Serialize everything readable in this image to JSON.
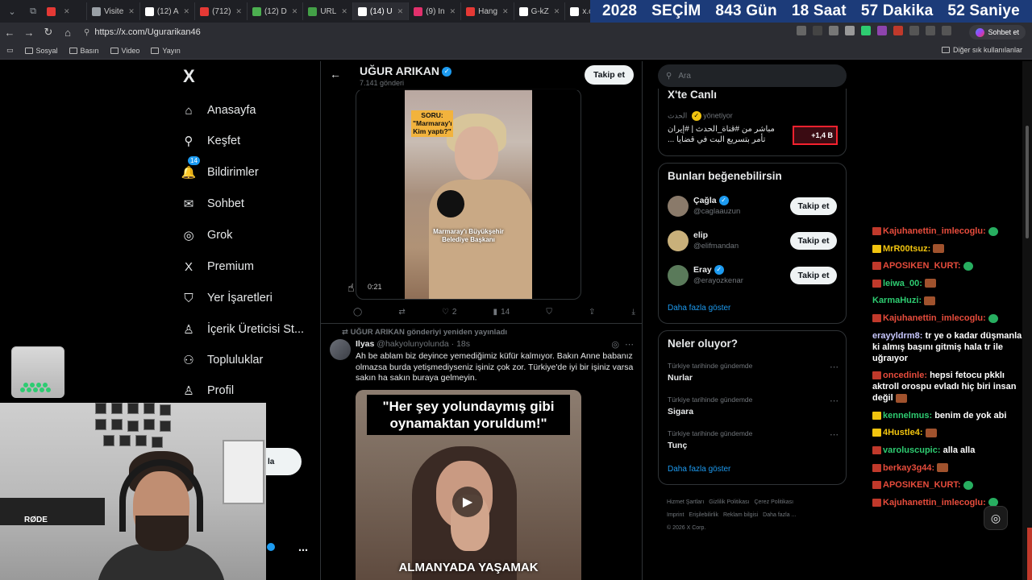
{
  "browser": {
    "tabs": [
      {
        "label": "",
        "color": "#e53935"
      },
      {
        "label": "Visite",
        "color": "#9aa0a6"
      },
      {
        "label": "(12) A",
        "color": "#ffffff"
      },
      {
        "label": "(712)",
        "color": "#e53935"
      },
      {
        "label": "(12) D",
        "color": "#4caf50"
      },
      {
        "label": "URL",
        "color": "#43a047"
      },
      {
        "label": "(14) U",
        "color": "#ffffff"
      },
      {
        "label": "(9) In",
        "color": "#e1306c"
      },
      {
        "label": "Hang",
        "color": "#e53935"
      },
      {
        "label": "G-kZ",
        "color": "#ffffff"
      },
      {
        "label": "x.con",
        "color": "#ffffff"
      },
      {
        "label": "x.con",
        "color": "#ffffff"
      }
    ],
    "countdown": [
      "2028",
      "SEÇİM",
      "843 Gün",
      "18 Saat",
      "57 Dakika",
      "52 Saniye"
    ],
    "url": "https://x.com/Ugurarikan46",
    "profile_label": "Sohbet et",
    "bookmarks": [
      "Sosyal",
      "Basın",
      "Video",
      "Yayın"
    ],
    "bookmarks_right": "Diğer sık kullanılanlar"
  },
  "nav": {
    "logo": "X",
    "items": [
      {
        "label": "Anasayfa",
        "icon": "home-icon",
        "glyph": "⌂"
      },
      {
        "label": "Keşfet",
        "icon": "search-icon",
        "glyph": "⚲"
      },
      {
        "label": "Bildirimler",
        "icon": "bell-icon",
        "glyph": "🔔",
        "badge": "14"
      },
      {
        "label": "Sohbet",
        "icon": "mail-icon",
        "glyph": "✉"
      },
      {
        "label": "Grok",
        "icon": "grok-icon",
        "glyph": "◎"
      },
      {
        "label": "Premium",
        "icon": "x-premium-icon",
        "glyph": "X"
      },
      {
        "label": "Yer İşaretleri",
        "icon": "bookmark-icon",
        "glyph": "⛉"
      },
      {
        "label": "İçerik Üreticisi St...",
        "icon": "creator-studio-icon",
        "glyph": "♙"
      },
      {
        "label": "Topluluklar",
        "icon": "communities-icon",
        "glyph": "⚇"
      },
      {
        "label": "Profil",
        "icon": "profile-icon",
        "glyph": "♙"
      }
    ],
    "post_button_fragment": "la"
  },
  "profile": {
    "name": "UĞUR ARIKAN",
    "posts_count": "7.141 gönderi",
    "follow_label": "Takip et"
  },
  "tweet1": {
    "video": {
      "question": "SORU: \"Marmaray'ı Kim yaptı?\"",
      "caption": "Marmaray'ı Büyükşehir Belediye Başkanı",
      "time": "0:21"
    },
    "actions": {
      "reply": "",
      "repost": "",
      "likes": "2",
      "views": "14"
    }
  },
  "tweet2": {
    "repost_note": "UĞUR ARIKAN gönderiyi yeniden yayınladı",
    "author": "Ilyas",
    "handle": "@hakyolunyolunda · 18s",
    "text": "Ah be ablam biz deyince yemediğimiz küfür kalmıyor. Bakın Anne babanız olmazsa burda yetişmediyseniz işiniz çok zor. Türkiye'de iyi bir işiniz varsa sakın ha sakın buraya gelmeyin.",
    "video_title": "\"Her şey yolundaymış gibi oynamaktan yoruldum!\"",
    "video_bottom": "ALMANYADA YAŞAMAK"
  },
  "right": {
    "search_placeholder": "Ara",
    "live": {
      "title": "X'te Canlı",
      "host": "الحدث",
      "host_suffix": "yönetiyor",
      "text": "مباشر من #قناة_الحدث | #إيران تأمر بتسريع البت في قضايا ...",
      "count": "+1,4 B"
    },
    "suggestions": {
      "title": "Bunları beğenebilirsin",
      "items": [
        {
          "name": "Çağla",
          "handle": "@caglaauzun",
          "verified": true,
          "follow": "Takip et"
        },
        {
          "name": "elip",
          "handle": "@elifmandan",
          "verified": false,
          "follow": "Takip et"
        },
        {
          "name": "Eray",
          "handle": "@erayozkenar",
          "verified": true,
          "follow": "Takip et"
        }
      ],
      "more": "Daha fazla göster"
    },
    "trends": {
      "title": "Neler oluyor?",
      "items": [
        {
          "context": "Türkiye tarihinde gündemde",
          "topic": "Nurlar"
        },
        {
          "context": "Türkiye tarihinde gündemde",
          "topic": "Sigara"
        },
        {
          "context": "Türkiye tarihinde gündemde",
          "topic": "Tunç"
        }
      ],
      "more": "Daha fazla göster"
    },
    "footer": [
      "Hizmet Şartları",
      "Gizlilik Politikası",
      "Çerez Politikası",
      "Imprint",
      "Erişilebilirlik",
      "Reklam bilgisi",
      "Daha fazla ...",
      "© 2026 X Corp."
    ]
  },
  "chat": [
    {
      "user": "Kajuhanettin_imlecoglu:",
      "text": "",
      "color": "#e74c3c",
      "badge": "r",
      "emote": "g"
    },
    {
      "user": "MrR00tsuz:",
      "text": "",
      "color": "#f1c40f",
      "badge": "y",
      "emote": "b"
    },
    {
      "user": "APOSIKEN_KURT:",
      "text": "",
      "color": "#e74c3c",
      "badge": "r",
      "emote": "g"
    },
    {
      "user": "leiwa_00:",
      "text": "",
      "color": "#2ecc71",
      "badge": "r",
      "emote": "b"
    },
    {
      "user": "KarmaHuzi:",
      "text": "",
      "color": "#2ecc71",
      "badge": "",
      "emote": "b"
    },
    {
      "user": "Kajuhanettin_imlecoglu:",
      "text": "",
      "color": "#e74c3c",
      "badge": "r",
      "emote": "g"
    },
    {
      "user": "erayyldrm8:",
      "text": "tr ye o kadar düşmanlar ki almış başını gitmiş hala tr ile uğraıyor",
      "color": "#c8c8ff",
      "badge": "",
      "emote": ""
    },
    {
      "user": "oncedinle:",
      "text": "hepsi fetocu pkklı aktroll orospu evladı hiç biri insan değil",
      "color": "#e74c3c",
      "badge": "r",
      "emote": "b"
    },
    {
      "user": "kennelmus:",
      "text": "benim de yok abi",
      "color": "#2ecc71",
      "badge": "y",
      "emote": ""
    },
    {
      "user": "4Hustle4:",
      "text": "",
      "color": "#f1c40f",
      "badge": "y",
      "emote": "b"
    },
    {
      "user": "varoluscupic:",
      "text": "alla alla",
      "color": "#2ecc71",
      "badge": "r",
      "emote": ""
    },
    {
      "user": "berkay3g44:",
      "text": "",
      "color": "#e74c3c",
      "badge": "r",
      "emote": "b"
    },
    {
      "user": "APOSIKEN_KURT:",
      "text": "",
      "color": "#e74c3c",
      "badge": "r",
      "emote": "g"
    },
    {
      "user": "Kajuhanettin_imlecoglu:",
      "text": "",
      "color": "#e74c3c",
      "badge": "r",
      "emote": "g"
    }
  ],
  "webcam": {
    "mic_brand": "RØDE"
  }
}
